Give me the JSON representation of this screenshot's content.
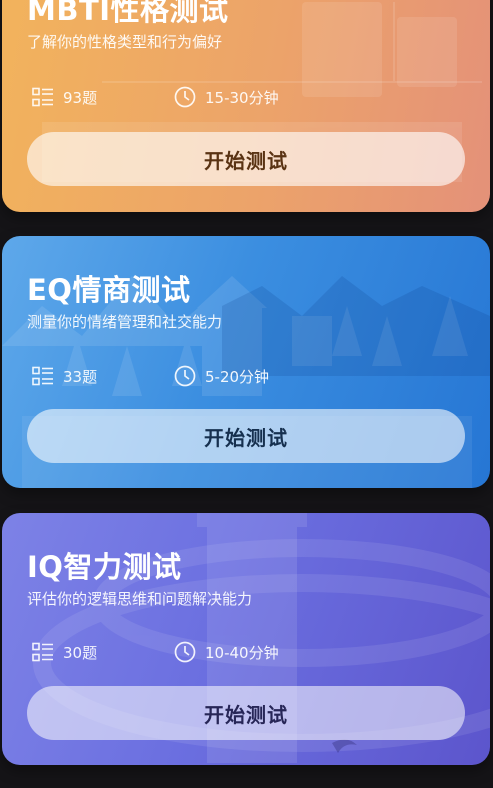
{
  "cards": [
    {
      "title": "MBTI性格测试",
      "subtitle": "了解你的性格类型和行为偏好",
      "questions": "93题",
      "duration": "15-30分钟",
      "button_label": "开始测试"
    },
    {
      "title": "EQ情商测试",
      "subtitle": "测量你的情绪管理和社交能力",
      "questions": "33题",
      "duration": "5-20分钟",
      "button_label": "开始测试"
    },
    {
      "title": "IQ智力测试",
      "subtitle": "评估你的逻辑思维和问题解决能力",
      "questions": "30题",
      "duration": "10-40分钟",
      "button_label": "开始测试"
    }
  ],
  "icons": {
    "questions": "list-icon",
    "duration": "clock-icon"
  },
  "colors": {
    "background": "#151417",
    "mbti_gradient": [
      "#f2b35c",
      "#e49179"
    ],
    "eq_gradient": [
      "#5ea8ea",
      "#2676d4"
    ],
    "iq_gradient": [
      "#7d82e6",
      "#5c55cc"
    ]
  }
}
